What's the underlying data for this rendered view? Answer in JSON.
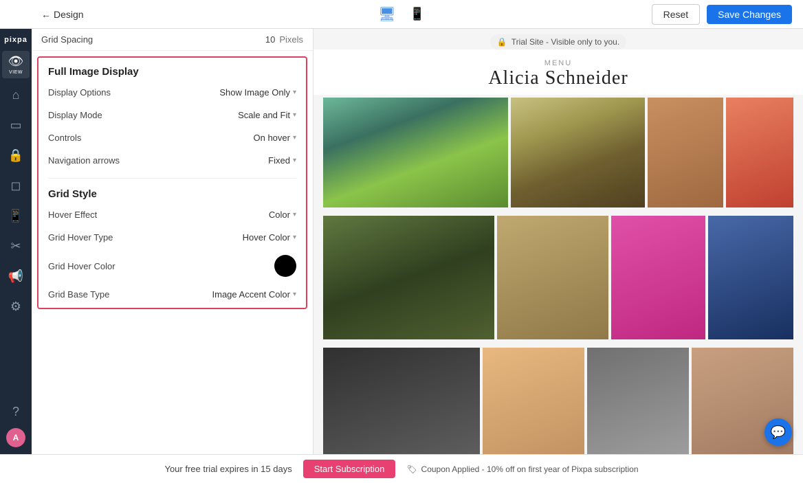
{
  "topbar": {
    "back_label": "Design",
    "reset_label": "Reset",
    "save_label": "Save Changes"
  },
  "nav": {
    "logo": "pixpa",
    "items": [
      {
        "id": "view",
        "icon": "👁",
        "label": "VIEW",
        "active": true
      },
      {
        "id": "home",
        "icon": "⌂",
        "label": "",
        "active": false
      },
      {
        "id": "pages",
        "icon": "▭",
        "label": "",
        "active": false
      },
      {
        "id": "store",
        "icon": "🔒",
        "label": "",
        "active": false
      },
      {
        "id": "cart",
        "icon": "◻",
        "label": "",
        "active": false
      },
      {
        "id": "mobile",
        "icon": "📱",
        "label": "",
        "active": false
      },
      {
        "id": "design2",
        "icon": "✂",
        "label": "",
        "active": false
      },
      {
        "id": "marketing",
        "icon": "📢",
        "label": "",
        "active": false
      },
      {
        "id": "settings",
        "icon": "⚙",
        "label": "",
        "active": false
      },
      {
        "id": "help",
        "icon": "?",
        "label": "",
        "active": false
      },
      {
        "id": "avatar",
        "label": "A"
      }
    ]
  },
  "grid_spacing": {
    "label": "Grid Spacing",
    "value": "10",
    "unit": "Pixels"
  },
  "full_image_display": {
    "section_title": "Full Image Display",
    "display_options": {
      "label": "Display Options",
      "value": "Show Image Only"
    },
    "display_mode": {
      "label": "Display Mode",
      "value": "Scale and Fit"
    },
    "controls": {
      "label": "Controls",
      "value": "On hover"
    },
    "navigation_arrows": {
      "label": "Navigation arrows",
      "value": "Fixed"
    }
  },
  "grid_style": {
    "section_title": "Grid Style",
    "hover_effect": {
      "label": "Hover Effect",
      "value": "Color"
    },
    "grid_hover_type": {
      "label": "Grid Hover Type",
      "value": "Hover Color"
    },
    "grid_hover_color": {
      "label": "Grid Hover Color",
      "color": "#000000"
    },
    "grid_base_type": {
      "label": "Grid Base Type",
      "value": "Image Accent Color"
    }
  },
  "site": {
    "menu_label": "MENU",
    "title": "Alicia Schneider"
  },
  "trial_bar": {
    "text": "Your free trial expires in 15 days",
    "subscribe_label": "Start Subscription",
    "coupon_label": "Coupon Applied - 10% off on first year of Pixpa subscription",
    "trial_notice": "Trial Site - Visible only to you."
  }
}
